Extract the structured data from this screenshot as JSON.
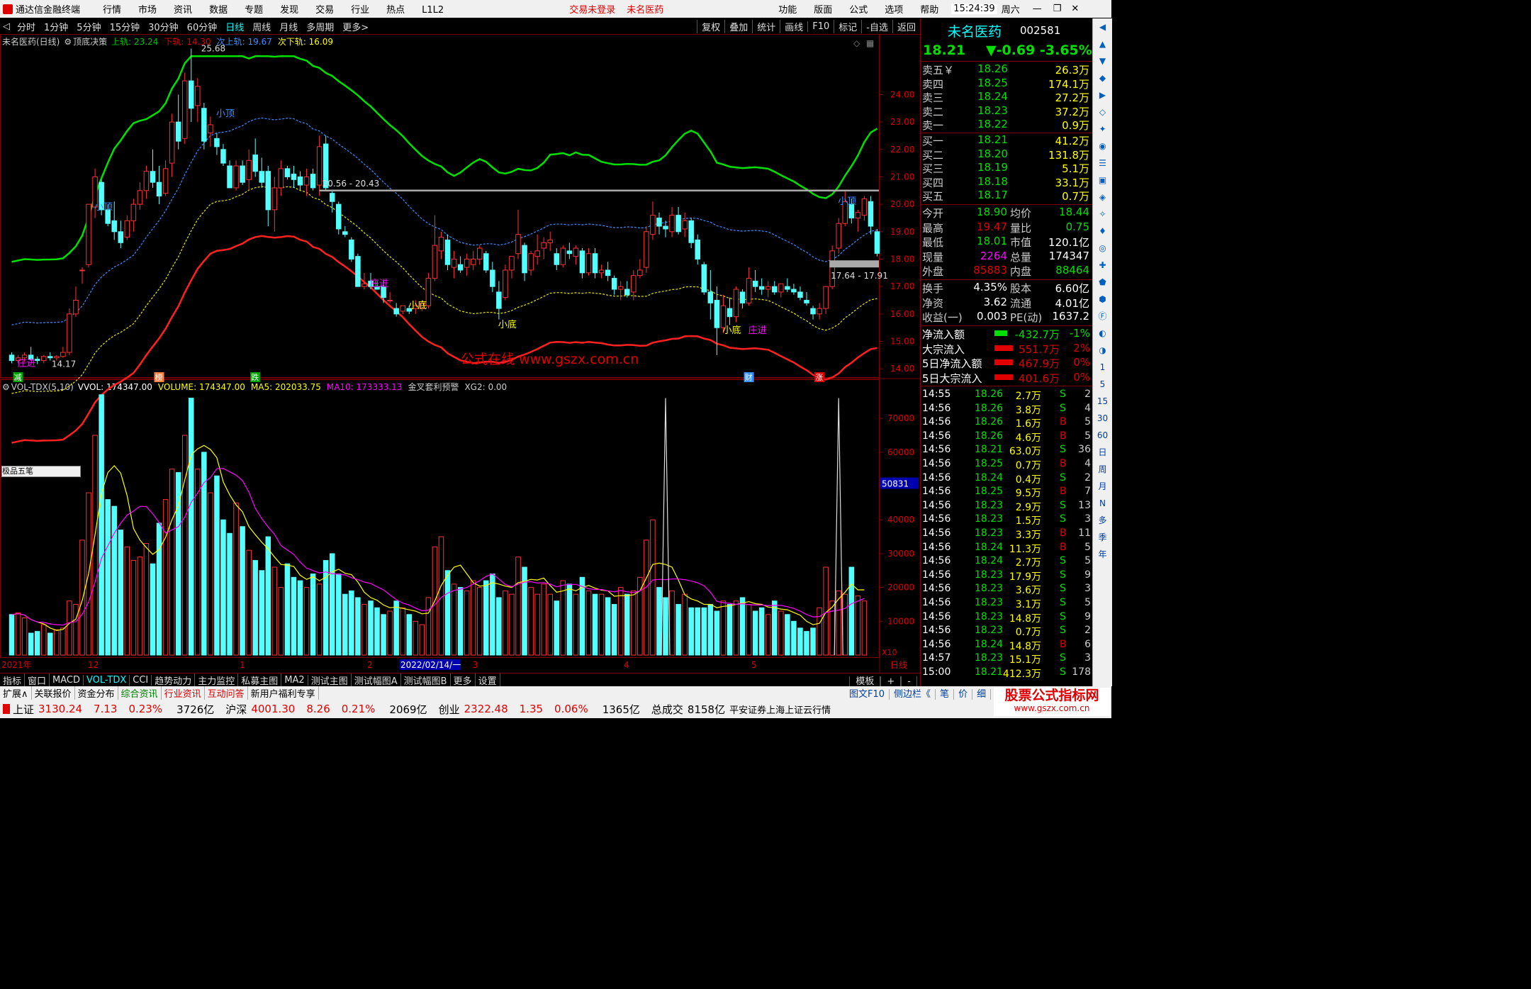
{
  "topbar": {
    "app_title": "通达信金融终端",
    "menu": [
      "行情",
      "市场",
      "资讯",
      "数据",
      "专题",
      "发现",
      "交易",
      "行业",
      "热点",
      "L1L2"
    ],
    "alert1": "交易未登录",
    "alert2": "未名医药",
    "right_menu": [
      "功能",
      "版面",
      "公式",
      "选项",
      "帮助"
    ],
    "time": "15:24:39",
    "weekday": "周六"
  },
  "periods": [
    "分时",
    "1分钟",
    "5分钟",
    "15分钟",
    "30分钟",
    "60分钟",
    "日线",
    "周线",
    "月线",
    "多周期",
    "更多>"
  ],
  "tools": [
    "复权",
    "叠加",
    "统计",
    "画线",
    "F10",
    "标记",
    "-自选",
    "返回"
  ],
  "indicator_bar": {
    "name": "未名医药(日线)",
    "formula": "顶底决策",
    "u1": "上轨: 23.24",
    "d1": "下轨: 14.30",
    "u2": "次上轨: 19.67",
    "d2": "次下轨: 16.09"
  },
  "vol_bar": {
    "name": "VOL-TDX(5,10)",
    "vvol": "VVOL: 174347.00",
    "volume": "VOLUME: 174347.00",
    "ma5": "MA5: 202033.75",
    "ma10": "MA10: 173333.13",
    "alert": "金叉套利预警",
    "xg2": "XG2: 0.00"
  },
  "chart_data": {
    "type": "candlestick",
    "price_axis_ticks": [
      "24.00",
      "23.00",
      "22.00",
      "21.00",
      "20.00",
      "19.00",
      "18.00",
      "17.00",
      "16.00",
      "15.00",
      "14.00"
    ],
    "ylim": [
      13.85,
      25.95
    ],
    "annotations": {
      "high": "25.68",
      "low": "14.17",
      "range_top": "20.56 - 20.43",
      "range_bottom": "17.64 - 17.91",
      "labels": [
        "小顶",
        "小顶",
        "小顶",
        "小底",
        "小底",
        "小底",
        "庄进",
        "庄进",
        "庄进"
      ],
      "badges": [
        "减",
        "榜",
        "跌",
        "财",
        "涨"
      ]
    },
    "candles": [
      [
        14.5,
        14.6,
        14.2,
        14.3
      ],
      [
        14.3,
        14.5,
        14.2,
        14.4
      ],
      [
        14.4,
        14.6,
        14.25,
        14.5
      ],
      [
        14.5,
        14.8,
        14.3,
        14.35
      ],
      [
        14.35,
        14.45,
        14.17,
        14.3
      ],
      [
        14.3,
        14.5,
        14.2,
        14.45
      ],
      [
        14.45,
        14.6,
        14.3,
        14.4
      ],
      [
        14.4,
        14.5,
        14.3,
        14.45
      ],
      [
        14.45,
        14.8,
        14.4,
        14.6
      ],
      [
        14.6,
        16.2,
        14.5,
        16.0
      ],
      [
        16.0,
        17.0,
        15.9,
        16.5
      ],
      [
        17.6,
        17.7,
        17.1,
        17.6
      ],
      [
        17.8,
        20.0,
        17.7,
        20.0
      ],
      [
        19.9,
        21.3,
        19.5,
        21.0
      ],
      [
        20.8,
        20.9,
        19.6,
        19.8
      ],
      [
        19.8,
        20.0,
        19.2,
        19.3
      ],
      [
        19.4,
        20.1,
        18.7,
        19.0
      ],
      [
        19.0,
        19.4,
        18.4,
        18.6
      ],
      [
        18.8,
        19.6,
        18.7,
        19.4
      ],
      [
        19.4,
        20.2,
        19.0,
        20.0
      ],
      [
        20.0,
        20.8,
        19.8,
        20.5
      ],
      [
        20.5,
        21.4,
        20.2,
        21.2
      ],
      [
        21.2,
        22.0,
        20.6,
        20.8
      ],
      [
        20.8,
        21.4,
        20.0,
        20.3
      ],
      [
        20.4,
        21.6,
        20.3,
        21.3
      ],
      [
        21.5,
        23.3,
        21.0,
        23.0
      ],
      [
        23.0,
        24.0,
        22.0,
        22.3
      ],
      [
        22.4,
        24.8,
        22.2,
        24.5
      ],
      [
        24.5,
        25.68,
        23.0,
        23.5
      ],
      [
        23.6,
        24.6,
        23.0,
        24.3
      ],
      [
        23.5,
        23.7,
        22.0,
        22.3
      ],
      [
        22.6,
        23.2,
        22.1,
        22.9
      ],
      [
        22.4,
        22.6,
        21.8,
        22.1
      ],
      [
        22.0,
        22.2,
        21.4,
        21.5
      ],
      [
        21.4,
        21.6,
        20.6,
        20.6
      ],
      [
        20.6,
        21.6,
        20.5,
        21.4
      ],
      [
        21.4,
        21.6,
        20.7,
        20.8
      ],
      [
        20.9,
        22.0,
        20.5,
        21.6
      ],
      [
        21.8,
        22.4,
        21.0,
        21.2
      ],
      [
        21.2,
        21.7,
        20.6,
        20.8
      ],
      [
        21.2,
        21.4,
        19.2,
        19.8
      ],
      [
        19.8,
        21.0,
        19.0,
        20.6
      ],
      [
        20.6,
        21.6,
        20.3,
        21.3
      ],
      [
        21.3,
        21.4,
        20.9,
        21.0
      ],
      [
        21.1,
        21.4,
        20.6,
        20.9
      ],
      [
        21.0,
        21.2,
        20.5,
        20.7
      ],
      [
        20.7,
        21.3,
        20.3,
        21.0
      ],
      [
        21.1,
        21.3,
        20.5,
        20.6
      ],
      [
        20.7,
        22.5,
        20.3,
        22.1
      ],
      [
        22.2,
        22.5,
        20.5,
        20.6
      ],
      [
        20.4,
        20.5,
        19.7,
        20.1
      ],
      [
        20.0,
        20.1,
        18.9,
        19.1
      ],
      [
        19.0,
        19.2,
        18.8,
        18.9
      ],
      [
        18.7,
        18.8,
        17.9,
        18.0
      ],
      [
        18.1,
        18.2,
        17.0,
        17.0
      ],
      [
        17.0,
        17.5,
        16.9,
        17.1
      ],
      [
        17.2,
        17.5,
        16.9,
        17.0
      ],
      [
        17.0,
        17.2,
        16.9,
        16.9
      ],
      [
        17.0,
        17.2,
        16.4,
        16.6
      ],
      [
        16.5,
        16.8,
        16.4,
        16.5
      ],
      [
        16.2,
        16.4,
        15.9,
        16.0
      ],
      [
        16.1,
        16.3,
        16.0,
        16.3
      ],
      [
        16.2,
        16.3,
        16.0,
        16.1
      ],
      [
        16.2,
        16.5,
        16.0,
        16.3
      ],
      [
        16.2,
        16.5,
        16.1,
        16.4
      ],
      [
        16.3,
        17.5,
        16.2,
        17.3
      ],
      [
        17.3,
        19.6,
        17.2,
        18.5
      ],
      [
        18.3,
        19.0,
        18.0,
        18.8
      ],
      [
        18.7,
        18.9,
        17.6,
        17.8
      ],
      [
        17.7,
        18.3,
        17.3,
        18.0
      ],
      [
        17.8,
        18.1,
        17.5,
        17.6
      ],
      [
        17.7,
        18.2,
        17.4,
        18.0
      ],
      [
        17.8,
        18.3,
        17.6,
        18.0
      ],
      [
        18.0,
        18.5,
        17.8,
        18.4
      ],
      [
        18.2,
        18.3,
        17.5,
        17.6
      ],
      [
        17.6,
        17.9,
        16.8,
        17.0
      ],
      [
        16.8,
        17.2,
        15.8,
        16.2
      ],
      [
        16.6,
        17.8,
        16.5,
        17.6
      ],
      [
        17.6,
        18.1,
        17.3,
        18.1
      ],
      [
        18.2,
        19.8,
        18.0,
        18.9
      ],
      [
        18.5,
        18.6,
        17.2,
        17.5
      ],
      [
        17.6,
        18.3,
        17.4,
        18.2
      ],
      [
        18.1,
        18.9,
        17.8,
        18.3
      ],
      [
        18.4,
        18.8,
        18.0,
        18.6
      ],
      [
        18.6,
        19.0,
        18.3,
        18.7
      ],
      [
        18.2,
        18.4,
        17.6,
        17.8
      ],
      [
        17.8,
        18.5,
        17.7,
        18.4
      ],
      [
        18.3,
        18.6,
        18.0,
        18.2
      ],
      [
        18.1,
        18.5,
        17.8,
        18.4
      ],
      [
        18.3,
        18.4,
        17.3,
        17.5
      ],
      [
        17.5,
        18.4,
        17.4,
        18.2
      ],
      [
        18.2,
        18.4,
        17.3,
        17.5
      ],
      [
        17.5,
        17.8,
        17.3,
        17.6
      ],
      [
        17.6,
        17.9,
        17.2,
        17.4
      ],
      [
        17.3,
        17.4,
        16.7,
        16.9
      ],
      [
        16.9,
        17.2,
        16.5,
        17.0
      ],
      [
        16.9,
        17.2,
        16.6,
        16.7
      ],
      [
        16.8,
        17.6,
        16.5,
        17.4
      ],
      [
        17.4,
        18.0,
        17.3,
        17.6
      ],
      [
        17.7,
        19.2,
        17.5,
        19.0
      ],
      [
        18.9,
        20.1,
        18.7,
        19.6
      ],
      [
        19.5,
        19.7,
        18.9,
        19.2
      ],
      [
        19.2,
        19.4,
        18.8,
        19.1
      ],
      [
        19.0,
        19.9,
        18.8,
        19.6
      ],
      [
        19.6,
        19.9,
        18.9,
        19.0
      ],
      [
        19.1,
        19.7,
        18.8,
        19.4
      ],
      [
        19.4,
        19.5,
        18.4,
        18.6
      ],
      [
        18.7,
        18.9,
        17.8,
        18.0
      ],
      [
        17.8,
        17.9,
        16.7,
        16.8
      ],
      [
        16.8,
        17.6,
        15.8,
        16.4
      ],
      [
        16.5,
        17.0,
        14.5,
        15.5
      ],
      [
        15.5,
        16.7,
        15.3,
        16.3
      ],
      [
        16.2,
        16.6,
        15.6,
        15.9
      ],
      [
        15.9,
        17.0,
        15.7,
        16.9
      ],
      [
        16.8,
        16.9,
        16.2,
        16.4
      ],
      [
        16.4,
        17.7,
        16.3,
        17.3
      ],
      [
        17.2,
        17.6,
        16.8,
        17.0
      ],
      [
        17.0,
        17.3,
        16.7,
        16.9
      ],
      [
        16.9,
        17.2,
        16.6,
        17.0
      ],
      [
        17.0,
        17.2,
        16.7,
        16.8
      ],
      [
        16.8,
        17.1,
        16.6,
        17.1
      ],
      [
        17.0,
        17.3,
        16.8,
        16.9
      ],
      [
        16.9,
        17.1,
        16.7,
        16.8
      ],
      [
        16.8,
        17.0,
        16.5,
        16.6
      ],
      [
        16.5,
        16.8,
        16.3,
        16.4
      ],
      [
        16.2,
        16.3,
        15.8,
        16.0
      ],
      [
        16.0,
        16.4,
        15.8,
        16.2
      ],
      [
        16.2,
        17.0,
        16.0,
        17.0
      ],
      [
        17.0,
        18.5,
        16.9,
        18.3
      ],
      [
        18.4,
        19.5,
        18.2,
        19.3
      ],
      [
        19.3,
        20.5,
        19.2,
        20.1
      ],
      [
        20.0,
        20.2,
        19.3,
        19.5
      ],
      [
        19.5,
        19.8,
        19.0,
        19.7
      ],
      [
        19.6,
        20.3,
        19.4,
        20.2
      ],
      [
        20.1,
        20.3,
        18.9,
        19.2
      ],
      [
        19.0,
        19.1,
        18.1,
        18.21
      ]
    ],
    "volume_axis_ticks": [
      "70000",
      "60000",
      "50000",
      "40000",
      "30000",
      "20000",
      "10000"
    ],
    "volume_unit": "X10",
    "volume_cursor": "50831",
    "volume_ylim": [
      0,
      78000
    ],
    "volumes": [
      12000,
      12500,
      11000,
      6500,
      7000,
      9000,
      6500,
      7500,
      8000,
      16000,
      15000,
      34000,
      48000,
      65000,
      77000,
      46000,
      44000,
      37000,
      32000,
      28000,
      29000,
      33000,
      27000,
      39000,
      46000,
      55000,
      54000,
      65000,
      76000,
      55000,
      60000,
      48000,
      53000,
      40000,
      36000,
      45000,
      38000,
      31000,
      28000,
      25000,
      35000,
      26000,
      20000,
      27000,
      23000,
      22000,
      20000,
      24000,
      21000,
      28000,
      30000,
      24000,
      18000,
      19000,
      17000,
      15000,
      16000,
      14000,
      12000,
      13000,
      16000,
      14000,
      12000,
      10000,
      9000,
      17000,
      32000,
      35000,
      25000,
      21000,
      20000,
      19000,
      22000,
      20000,
      22000,
      24000,
      17000,
      19000,
      18000,
      29000,
      26000,
      20000,
      18000,
      21000,
      18000,
      16000,
      22000,
      21000,
      18000,
      23000,
      19000,
      18000,
      18000,
      17000,
      15000,
      20000,
      18000,
      19000,
      23000,
      34000,
      40000,
      20000,
      17000,
      19000,
      15000,
      18000,
      14000,
      14000,
      14000,
      15000,
      13000,
      16000,
      15000,
      16000,
      17000,
      15000,
      13000,
      14000,
      12000,
      16000,
      13000,
      12000,
      10000,
      8000,
      7000,
      8000,
      14000,
      26000,
      16000,
      19000,
      18000,
      26000,
      17500,
      16000
    ],
    "date_labels": [
      "2021年",
      "12",
      "1",
      "2",
      "2022/02/14/一",
      "3",
      "4",
      "5",
      "日线"
    ]
  },
  "side": {
    "stock_name": "未名医药",
    "stock_code": "002581",
    "price": "18.21",
    "change": "▼-0.69",
    "pct": "-3.65%",
    "asks": [
      {
        "label": "卖五￥",
        "price": "18.26",
        "vol": "26.3万"
      },
      {
        "label": "卖四",
        "price": "18.25",
        "vol": "174.1万"
      },
      {
        "label": "卖三",
        "price": "18.24",
        "vol": "27.2万"
      },
      {
        "label": "卖二",
        "price": "18.23",
        "vol": "37.2万"
      },
      {
        "label": "卖一",
        "price": "18.22",
        "vol": "0.9万"
      }
    ],
    "bids": [
      {
        "label": "买一",
        "price": "18.21",
        "vol": "41.2万"
      },
      {
        "label": "买二",
        "price": "18.20",
        "vol": "131.8万"
      },
      {
        "label": "买三",
        "price": "18.19",
        "vol": "5.1万"
      },
      {
        "label": "买四",
        "price": "18.18",
        "vol": "33.1万"
      },
      {
        "label": "买五",
        "price": "18.17",
        "vol": "0.7万"
      }
    ],
    "stats": [
      {
        "k1": "今开",
        "v1": "18.90",
        "k2": "均价",
        "v2": "18.44"
      },
      {
        "k1": "最高",
        "v1": "19.47",
        "k2": "量比",
        "v2": "0.75"
      },
      {
        "k1": "最低",
        "v1": "18.01",
        "k2": "市值",
        "v2": "120.1亿"
      },
      {
        "k1": "现量",
        "v1": "2264",
        "k2": "总量",
        "v2": "174347"
      },
      {
        "k1": "外盘",
        "v1": "85883",
        "k2": "内盘",
        "v2": "88464"
      }
    ],
    "stats2": [
      {
        "k1": "换手",
        "v1": "4.35%",
        "k2": "股本",
        "v2": "6.60亿"
      },
      {
        "k1": "净资",
        "v1": "3.62",
        "k2": "流通",
        "v2": "4.01亿"
      },
      {
        "k1": "收益(一)",
        "v1": "0.003",
        "k2": "PE(动)",
        "v2": "1637.2"
      }
    ],
    "flows": [
      {
        "label": "净流入额",
        "value": "-432.7万",
        "pct": "-1%"
      },
      {
        "label": "大宗流入",
        "value": "551.7万",
        "pct": "2%"
      },
      {
        "label": "5日净流入额",
        "value": "467.9万",
        "pct": "0%"
      },
      {
        "label": "5日大宗流入",
        "value": "401.6万",
        "pct": "0%"
      }
    ],
    "ticks": [
      [
        "14:55",
        "18.26",
        "2.7万",
        "S",
        "2"
      ],
      [
        "14:56",
        "18.26",
        "3.8万",
        "S",
        "4"
      ],
      [
        "14:56",
        "18.26",
        "1.6万",
        "B",
        "5"
      ],
      [
        "14:56",
        "18.26",
        "4.6万",
        "B",
        "5"
      ],
      [
        "14:56",
        "18.21",
        "63.0万",
        "S",
        "36"
      ],
      [
        "14:56",
        "18.25",
        "0.7万",
        "B",
        "4"
      ],
      [
        "14:56",
        "18.24",
        "0.4万",
        "S",
        "2"
      ],
      [
        "14:56",
        "18.25",
        "9.5万",
        "B",
        "7"
      ],
      [
        "14:56",
        "18.23",
        "2.9万",
        "S",
        "13"
      ],
      [
        "14:56",
        "18.23",
        "1.5万",
        "S",
        "3"
      ],
      [
        "14:56",
        "18.23",
        "3.3万",
        "B",
        "11"
      ],
      [
        "14:56",
        "18.24",
        "11.3万",
        "B",
        "5"
      ],
      [
        "14:56",
        "18.24",
        "2.7万",
        "S",
        "5"
      ],
      [
        "14:56",
        "18.23",
        "17.9万",
        "S",
        "9"
      ],
      [
        "14:56",
        "18.23",
        "3.6万",
        "S",
        "3"
      ],
      [
        "14:56",
        "18.23",
        "3.1万",
        "S",
        "5"
      ],
      [
        "14:56",
        "18.23",
        "14.8万",
        "S",
        "9"
      ],
      [
        "14:56",
        "18.23",
        "0.7万",
        "S",
        "2"
      ],
      [
        "14:56",
        "18.24",
        "14.8万",
        "B",
        "6"
      ],
      [
        "14:57",
        "18.23",
        "15.1万",
        "S",
        "3"
      ],
      [
        "15:00",
        "18.21",
        "412.3万",
        "S",
        "178"
      ]
    ]
  },
  "strip_labels": [
    "1",
    "5",
    "15",
    "30",
    "60",
    "日",
    "周",
    "月",
    "N",
    "多",
    "季",
    "年"
  ],
  "tabs1": [
    "指标",
    "窗口",
    "MACD",
    "VOL-TDX",
    "CCI",
    "趋势动力",
    "主力监控",
    "私募主图",
    "MA2",
    "测试主图",
    "测试幅图A",
    "测试幅图B",
    "更多",
    "设置"
  ],
  "tabs1_right": [
    "模板",
    "+",
    "-"
  ],
  "tabs2": [
    "扩展∧",
    "关联报价",
    "资金分布",
    "综合资讯",
    "行业资讯",
    "互动问答",
    "新用户福利专享"
  ],
  "tabs2_right": [
    "图文F10",
    "侧边栏《",
    "笔",
    "价",
    "细"
  ],
  "status": [
    {
      "name": "上证",
      "price": "3130.24",
      "chg": "7.13",
      "pct": "0.23%",
      "amt": "3726亿"
    },
    {
      "name": "沪深",
      "price": "4001.30",
      "chg": "8.26",
      "pct": "0.21%",
      "amt": "2069亿"
    },
    {
      "name": "创业",
      "price": "2322.48",
      "chg": "1.35",
      "pct": "0.06%",
      "amt": "1365亿"
    }
  ],
  "status_total_label": "总成交",
  "status_total": "8158亿",
  "status_broker": "平安证券上海上证云行情",
  "watermark": "公式在线 www.gszx.com.cn",
  "logo": "股票公式指标网",
  "logo_url": "www.gszx.com.cn",
  "mini_box": "极品五笔",
  "colors": {
    "up": "#ff3232",
    "down": "#54ffff",
    "upper": "#00e000",
    "lower": "#ff2020",
    "mid_up": "#3a8fff",
    "mid_dn": "#e8e800"
  }
}
